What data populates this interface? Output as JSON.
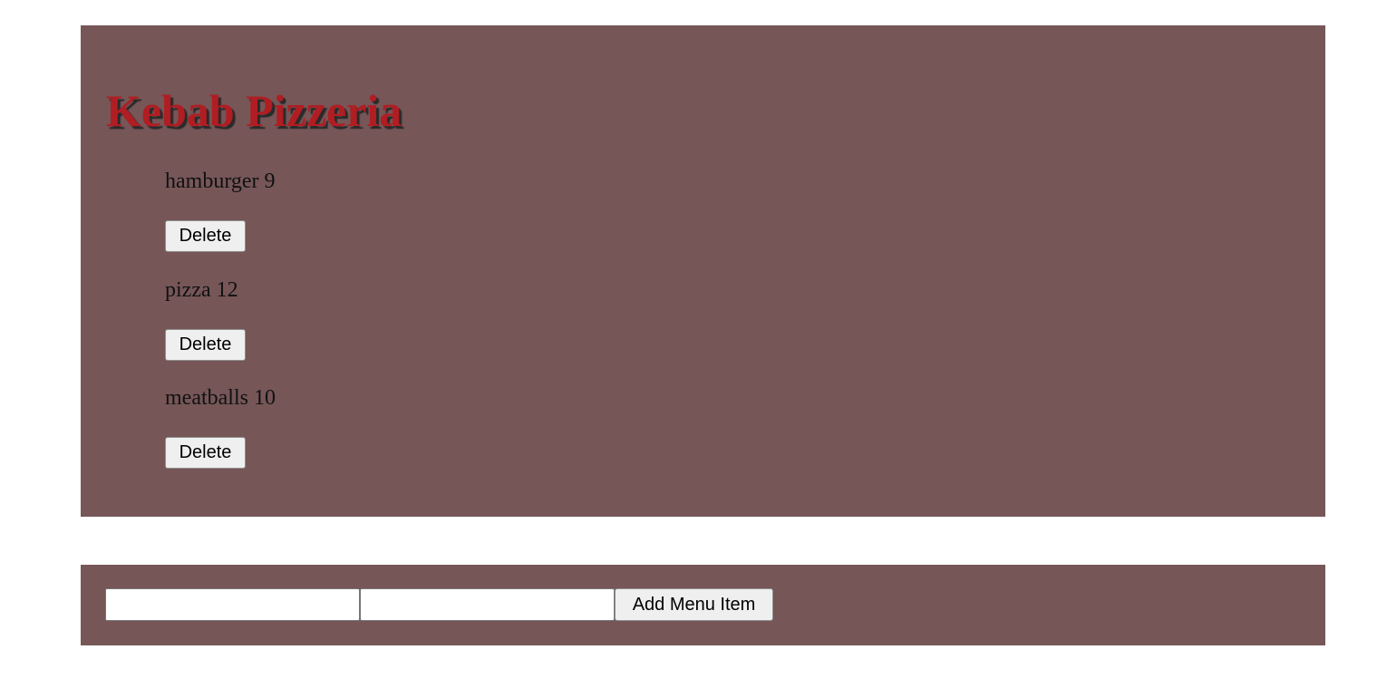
{
  "header": {
    "title": "Kebab Pizzeria"
  },
  "menu": {
    "items": [
      {
        "label": "hamburger 9",
        "delete_label": "Delete"
      },
      {
        "label": "pizza 12",
        "delete_label": "Delete"
      },
      {
        "label": "meatballs 10",
        "delete_label": "Delete"
      }
    ]
  },
  "add_form": {
    "name_input": {
      "value": "",
      "placeholder": ""
    },
    "price_input": {
      "value": "",
      "placeholder": ""
    },
    "submit_label": "Add Menu Item"
  },
  "colors": {
    "panel_background": "#765657",
    "title_color": "#b01d22",
    "page_background": "#ffffff"
  }
}
